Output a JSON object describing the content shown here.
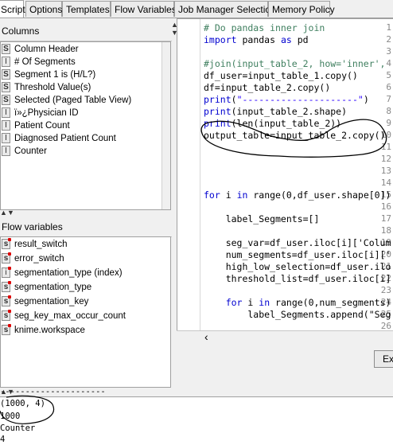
{
  "tabs": [
    {
      "label": "Script",
      "active": true
    },
    {
      "label": "Options"
    },
    {
      "label": "Templates"
    },
    {
      "label": "Flow Variables"
    },
    {
      "label": "Job Manager Selection"
    },
    {
      "label": "Memory Policy"
    }
  ],
  "columns": {
    "title": "Columns",
    "items": [
      {
        "type": "S",
        "label": "Column Header"
      },
      {
        "type": "I",
        "label": "# Of Segments"
      },
      {
        "type": "S",
        "label": "Segment 1 is (H/L?)"
      },
      {
        "type": "S",
        "label": "Threshold Value(s)"
      },
      {
        "type": "S",
        "label": "Selected (Paged Table View)"
      },
      {
        "type": "I",
        "label": "ï»¿Physician ID"
      },
      {
        "type": "I",
        "label": "Patient Count"
      },
      {
        "type": "I",
        "label": "Diagnosed Patient  Count"
      },
      {
        "type": "I",
        "label": "Counter"
      }
    ]
  },
  "flow_variables": {
    "title": "Flow variables",
    "items": [
      {
        "type": "s",
        "label": "result_switch"
      },
      {
        "type": "s",
        "label": "error_switch"
      },
      {
        "type": "i",
        "label": "segmentation_type (index)"
      },
      {
        "type": "s",
        "label": "segmentation_type"
      },
      {
        "type": "s",
        "label": "segmentation_key"
      },
      {
        "type": "s",
        "label": "seg_key_max_occur_count"
      },
      {
        "type": "s",
        "label": "knime.workspace"
      }
    ]
  },
  "editor": {
    "line_numbers": [
      "1",
      "2",
      "3",
      "4",
      "5",
      "6",
      "7",
      "8",
      "9",
      "10",
      "11",
      "12",
      "13",
      "14",
      "15",
      "16",
      "17",
      "18",
      "19",
      "20",
      "21",
      "22",
      "23",
      "24",
      "25",
      "26"
    ],
    "lines": [
      "# Do pandas inner join",
      "import pandas as pd",
      "",
      "#join(input_table_2, how='inner',",
      "df_user=input_table_1.copy()",
      "df=input_table_2.copy()",
      "print(\"---------------------\")",
      "print(input_table_2.shape)",
      "print(len(input_table_2))",
      "output_table=input_table_2.copy()",
      "",
      "",
      "",
      "",
      "for i in range(0,df_user.shape[0])",
      "",
      "    label_Segments=[]",
      "",
      "    seg_var=df_user.iloc[i]['Colum",
      "    num_segments=df_user.iloc[i]['",
      "    high_low_selection=df_user.ilo",
      "    threshold_list=df_user.iloc[i]",
      "",
      "    for i in range(0,num_segments)",
      "        label_Segments.append(\"Seg",
      ""
    ]
  },
  "execute_button": {
    "label": "Ex"
  },
  "console": {
    "lines": [
      "---------------------",
      "(1000, 4)",
      "1000",
      "Counter",
      "4"
    ]
  },
  "icons": {
    "scroll_left": "‹",
    "scroll_up": "▲",
    "scroll_down": "▼",
    "split_up": "▲",
    "split_down": "▼"
  },
  "colors": {
    "keyword": "#0000d0",
    "comment": "#3f7f5f",
    "string": "#2a00ff"
  }
}
